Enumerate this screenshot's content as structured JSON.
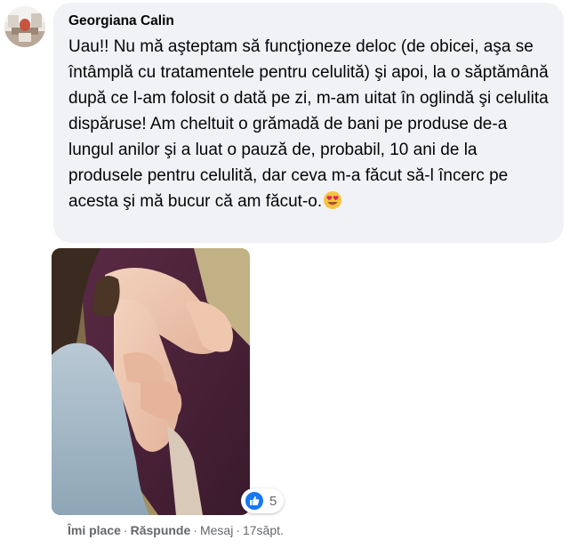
{
  "comment": {
    "author": "Georgiana Calin",
    "text": "Uau!! Nu mă aşteptam să funcţioneze deloc (de obicei, aşa se întâmplă cu tratamentele pentru celulită) şi apoi, la o săptămână după ce l-am folosit o dată pe zi, m-am uitat în oglindă şi celulita dispăruse! Am cheltuit o grămadă de bani pe produse de-a lungul anilor şi a luat o pauză de, probabil, 10 ani de la produsele pentru celulită, dar ceva m-a făcut să-l încerc pe acesta şi mă bucur că am făcut-o.",
    "emoji": "heart-eyes-emoji",
    "bubble_color": "#f0f2f5"
  },
  "reactions": {
    "icon": "like-icon",
    "count": "5",
    "color": "#1877f2"
  },
  "actions": {
    "like": "Îmi place",
    "reply": "Răspunde",
    "message": "Mesaj",
    "time": "17săpt.",
    "separator": "·"
  }
}
